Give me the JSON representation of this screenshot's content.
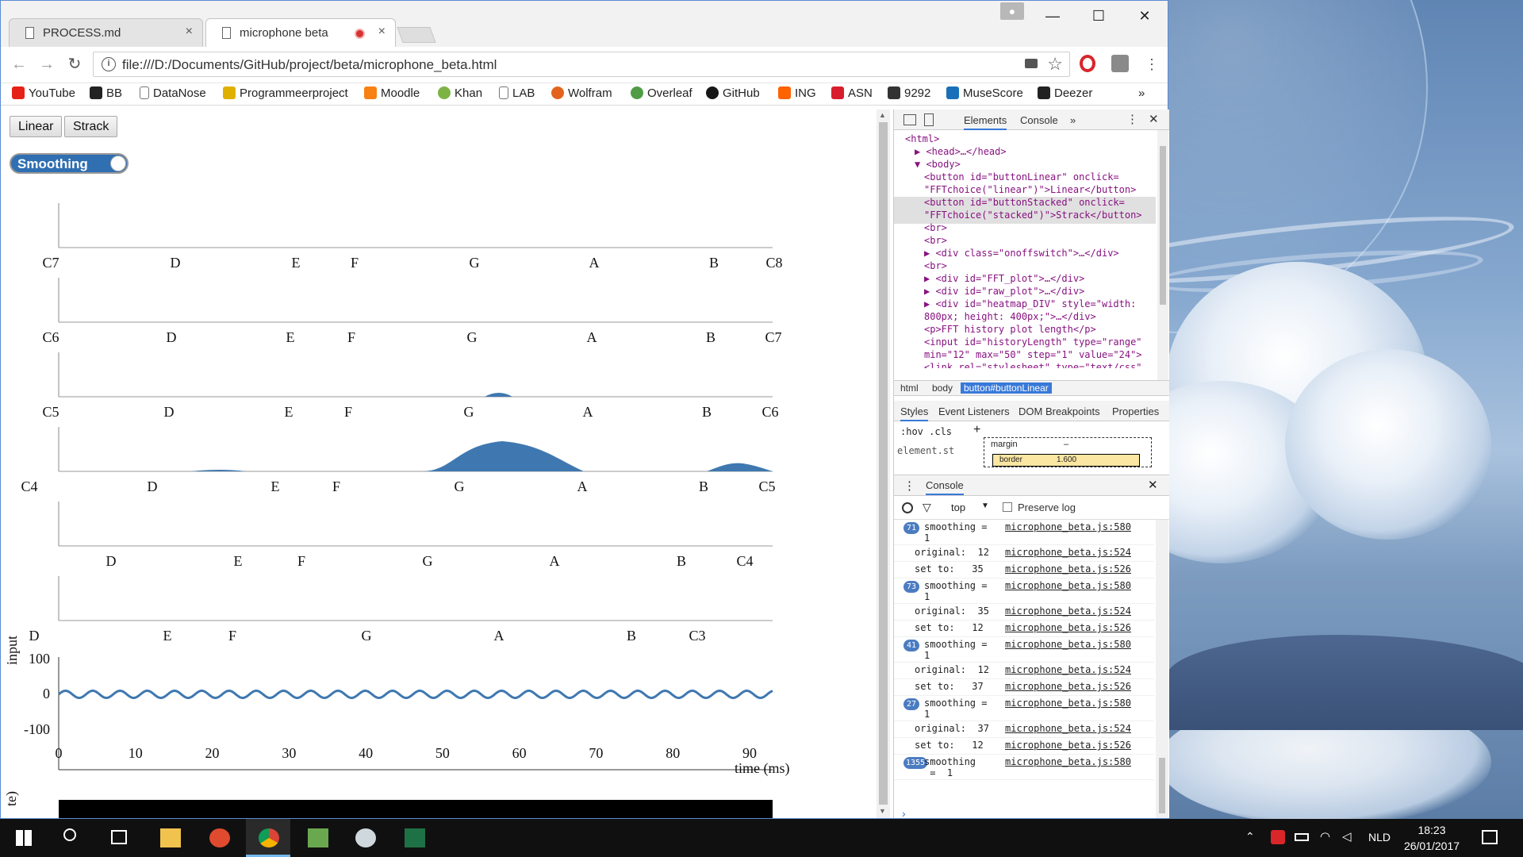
{
  "browser": {
    "tabs": [
      {
        "title": "PROCESS.md",
        "active": false,
        "recording": false
      },
      {
        "title": "microphone beta",
        "active": true,
        "recording": true
      }
    ],
    "url": "file:///D:/Documents/GitHub/project/beta/microphone_beta.html",
    "bookmarks": [
      "YouTube",
      "BB",
      "DataNose",
      "Programmeerproject",
      "Moodle",
      "Khan",
      "LAB",
      "Wolfram",
      "Overleaf",
      "GitHub",
      "ING",
      "ASN",
      "9292",
      "MuseScore",
      "Deezer"
    ],
    "bookmarks_more": "»"
  },
  "page": {
    "buttons": {
      "linear": "Linear",
      "stacked": "Strack"
    },
    "switch_label": "Smoothing",
    "octave_rows": [
      {
        "notes": [
          "C7",
          "D",
          "E",
          "F",
          "G",
          "A",
          "B",
          "C8"
        ]
      },
      {
        "notes": [
          "C6",
          "D",
          "E",
          "F",
          "G",
          "A",
          "B",
          "C7"
        ]
      },
      {
        "notes": [
          "C5",
          "D",
          "E",
          "F",
          "G",
          "A",
          "B",
          "C6"
        ]
      },
      {
        "notes": [
          "C4",
          "D",
          "E",
          "F",
          "G",
          "A",
          "B",
          "C5"
        ]
      },
      {
        "notes": [
          "D",
          "E",
          "F",
          "G",
          "A",
          "B",
          "C4"
        ]
      },
      {
        "notes": [
          "D",
          "E",
          "F",
          "G",
          "A",
          "B",
          "C3"
        ]
      }
    ],
    "raw_plot": {
      "ylabel": "input",
      "xlabel": "time (ms)",
      "yticks": [
        "100",
        "0",
        "-100"
      ],
      "xticks": [
        "0",
        "10",
        "20",
        "30",
        "40",
        "50",
        "60",
        "70",
        "80",
        "90"
      ]
    },
    "heatmap_label_fragment": "te)"
  },
  "chart_data": {
    "type": "line",
    "xlabel": "time (ms)",
    "ylabel": "input",
    "xlim": [
      0,
      93
    ],
    "ylim": [
      -140,
      140
    ],
    "waveform": {
      "amplitude": 10,
      "period_ms": 3.55,
      "baseline": 0
    }
  },
  "devtools": {
    "tabs": [
      "Elements",
      "Console"
    ],
    "more": "»",
    "dom": [
      {
        "indent": 0,
        "arrow": "",
        "text": "<html>"
      },
      {
        "indent": 1,
        "arrow": "▶",
        "text": "<head>…</head>"
      },
      {
        "indent": 1,
        "arrow": "▼",
        "text": "<body>"
      },
      {
        "indent": 2,
        "arrow": "",
        "text": "<button id=\"buttonLinear\" onclick="
      },
      {
        "indent": 2,
        "arrow": "",
        "text": "\"FFTchoice(\"linear\")\">Linear</button>"
      },
      {
        "indent": 2,
        "arrow": "",
        "text": "<button id=\"buttonStacked\" onclick="
      },
      {
        "indent": 2,
        "arrow": "",
        "text": "\"FFTchoice(\"stacked\")\">Strack</button>"
      },
      {
        "indent": 2,
        "arrow": "",
        "text": "<br>"
      },
      {
        "indent": 2,
        "arrow": "",
        "text": "<br>"
      },
      {
        "indent": 2,
        "arrow": "▶",
        "text": "<div class=\"onoffswitch\">…</div>"
      },
      {
        "indent": 2,
        "arrow": "",
        "text": "<br>"
      },
      {
        "indent": 2,
        "arrow": "▶",
        "text": "<div id=\"FFT_plot\">…</div>"
      },
      {
        "indent": 2,
        "arrow": "▶",
        "text": "<div id=\"raw_plot\">…</div>"
      },
      {
        "indent": 2,
        "arrow": "▶",
        "text": "<div id=\"heatmap_DIV\" style=\"width:"
      },
      {
        "indent": 2,
        "arrow": "",
        "text": "800px; height: 400px;\">…</div>"
      },
      {
        "indent": 2,
        "arrow": "",
        "text": "<p>FFT history plot length</p>"
      },
      {
        "indent": 2,
        "arrow": "",
        "text": "<input id=\"historyLength\" type=\"range\""
      },
      {
        "indent": 2,
        "arrow": "",
        "text": "min=\"12\" max=\"50\" step=\"1\" value=\"24\">"
      },
      {
        "indent": 2,
        "arrow": "",
        "text": "<link rel=\"stylesheet\" type=\"text/css\""
      }
    ],
    "crumbs": [
      "html",
      "body",
      "button#buttonLinear"
    ],
    "styles_tabs": [
      "Styles",
      "Event Listeners",
      "DOM Breakpoints",
      "Properties"
    ],
    "styles_filter": ":hov  .cls",
    "styles_element": "element.style {",
    "boxmodel": {
      "margin": "margin",
      "dash": "–",
      "border": "border",
      "border_val": "1.600"
    },
    "console_title": "Console",
    "context": "top",
    "preserve_log": "Preserve log",
    "logs": [
      {
        "badge": "71",
        "msg": "smoothing =\n1",
        "src": "microphone_beta.js:580"
      },
      {
        "badge": "",
        "msg": "original:  12",
        "src": "microphone_beta.js:524"
      },
      {
        "badge": "",
        "msg": "set to:   35",
        "src": "microphone_beta.js:526"
      },
      {
        "badge": "73",
        "msg": "smoothing =\n1",
        "src": "microphone_beta.js:580"
      },
      {
        "badge": "",
        "msg": "original:  35",
        "src": "microphone_beta.js:524"
      },
      {
        "badge": "",
        "msg": "set to:   12",
        "src": "microphone_beta.js:526"
      },
      {
        "badge": "41",
        "msg": "smoothing =\n1",
        "src": "microphone_beta.js:580"
      },
      {
        "badge": "",
        "msg": "original:  12",
        "src": "microphone_beta.js:524"
      },
      {
        "badge": "",
        "msg": "set to:   37",
        "src": "microphone_beta.js:526"
      },
      {
        "badge": "27",
        "msg": "smoothing =\n1",
        "src": "microphone_beta.js:580"
      },
      {
        "badge": "",
        "msg": "original:  37",
        "src": "microphone_beta.js:524"
      },
      {
        "badge": "",
        "msg": "set to:   12",
        "src": "microphone_beta.js:526"
      },
      {
        "badge": "1355",
        "msg": "smoothing\n =  1",
        "src": "microphone_beta.js:580"
      }
    ],
    "prompt": "›"
  },
  "taskbar": {
    "language": "NLD",
    "time": "18:23",
    "date": "26/01/2017"
  },
  "colors": {
    "accent": "#3879d9",
    "plot": "#3f78b0",
    "switch": "#2f6fb2"
  }
}
